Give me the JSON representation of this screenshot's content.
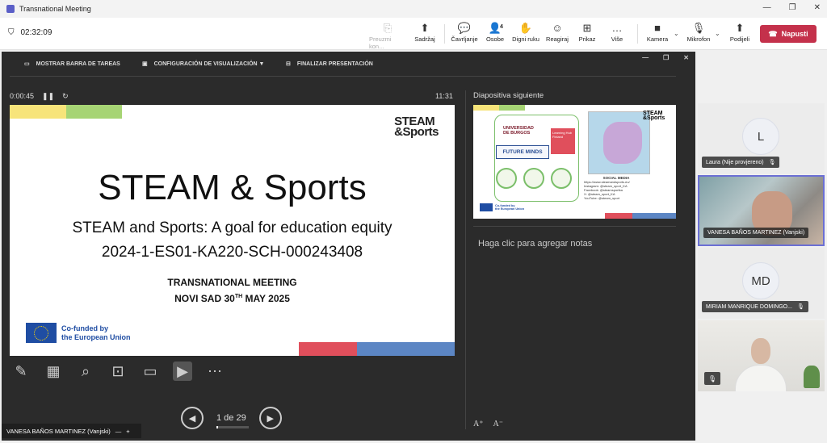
{
  "window": {
    "title": "Transnational Meeting",
    "controls": [
      "—",
      "❐",
      "✕"
    ]
  },
  "toolbar": {
    "call_time": "02:32:09",
    "items": [
      {
        "label": "Preuzmi kon...",
        "icon": "⎘"
      },
      {
        "label": "Sadržaj",
        "icon": "⬆"
      },
      {
        "label": "Čavrljanje",
        "icon": "💬"
      },
      {
        "label": "Osobe",
        "icon": "👤",
        "badge": "4"
      },
      {
        "label": "Digni ruku",
        "icon": "✋"
      },
      {
        "label": "Reagiraj",
        "icon": "☺"
      },
      {
        "label": "Prikaz",
        "icon": "⊞"
      },
      {
        "label": "Više",
        "icon": "…"
      },
      {
        "label": "Kamera",
        "icon": "■"
      },
      {
        "label": "Mikrofon",
        "icon": "🎙"
      },
      {
        "label": "Podijeli",
        "icon": "⬆"
      }
    ],
    "leave_label": "Napusti"
  },
  "presenter": {
    "top_items": [
      "MOSTRAR BARRA DE TAREAS",
      "CONFIGURACIÓN DE VISUALIZACIÓN ▼",
      "FINALIZAR PRESENTACIÓN"
    ],
    "elapsed": "0:00:45",
    "clock": "11:31",
    "page_indicator": "1 de 29",
    "next_label": "Diapositiva siguiente",
    "notes_placeholder": "Haga clic para agregar notas",
    "presenter_name": "VANESA BAÑOS MARTINEZ (Vanjski)"
  },
  "slide": {
    "logo_line1": "STEAM",
    "logo_line2": "&Sports",
    "title": "STEAM & Sports",
    "subtitle": "STEAM and Sports: A goal for education equity",
    "code": "2024-1-ES01-KA220-SCH-000243408",
    "meeting": "TRANSNATIONAL MEETING",
    "date_pre": "NOVI SAD 30",
    "date_sup": "TH",
    "date_post": " MAY 2025",
    "eu_line1": "Co-funded by",
    "eu_line2": "the European Union"
  },
  "next_slide": {
    "univ_line1": "UNIVERSIDAD",
    "univ_line2": "DE BURGOS",
    "lh": "Learning Hub Finland",
    "fm": "FUTURE MINDS",
    "social_title": "SOCIAL MEDIA",
    "social_lines": [
      "https://www.steamandsports.eu/",
      "Instagram: @steam_sport_KA",
      "Facebook: @steamsportka",
      "X: @steam_sport_KA",
      "YouTube: @steam_sport"
    ],
    "eu_line1": "Co-funded by",
    "eu_line2": "the European Union"
  },
  "participants": [
    {
      "initial": "L",
      "name": "Laura (Nije provjereno)"
    },
    {
      "name": "VANESA BAÑOS MARTINEZ (Vanjski)"
    },
    {
      "initial": "MD",
      "name": "MIRIAM MANRIQUE DOMINGO..."
    }
  ]
}
